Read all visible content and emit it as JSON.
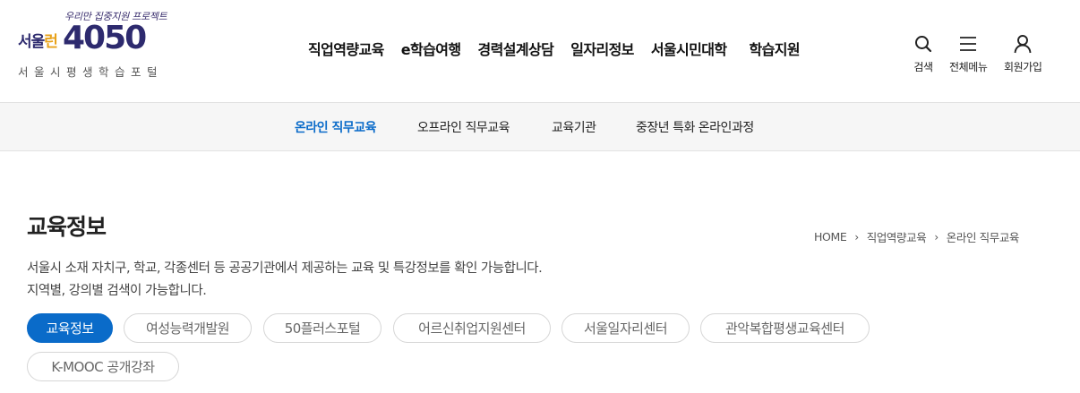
{
  "logo": {
    "slogan": "우리만 집중지원 프로젝트",
    "brand_a": "서울",
    "brand_b": "런",
    "number": "4050",
    "subtitle": "서울시평생학습포털"
  },
  "gnb": [
    "직업역량교육",
    "e학습여행",
    "경력설계상담",
    "일자리정보",
    "서울시민대학",
    "학습지원"
  ],
  "utility": [
    {
      "icon": "search-icon",
      "label": "검색"
    },
    {
      "icon": "menu-icon",
      "label": "전체메뉴"
    },
    {
      "icon": "user-icon",
      "label": "회원가입"
    }
  ],
  "subnav": [
    "온라인 직무교육",
    "오프라인 직무교육",
    "교육기관",
    "중장년 특화 온라인과정"
  ],
  "subnav_active": "온라인 직무교육",
  "page": {
    "title": "교육정보",
    "desc_line1": "서울시 소재 자치구, 학교, 각종센터 등 공공기관에서 제공하는 교육 및 특강정보를 확인 가능합니다.",
    "desc_line2": "지역별, 강의별 검색이 가능합니다."
  },
  "breadcrumb": [
    "HOME",
    "직업역량교육",
    "온라인 직무교육"
  ],
  "chips": [
    "교육정보",
    "여성능력개발원",
    "50플러스포털",
    "어르신취업지원센터",
    "서울일자리센터",
    "관악복합평생교육센터",
    "K-MOOC 공개강좌"
  ],
  "chips_active": "교육정보",
  "colors": {
    "accent": "#0a6bc9",
    "brand_navy": "#2d2a6e",
    "brand_orange": "#e8a21a",
    "subnav_bg": "#f6f6f6"
  }
}
